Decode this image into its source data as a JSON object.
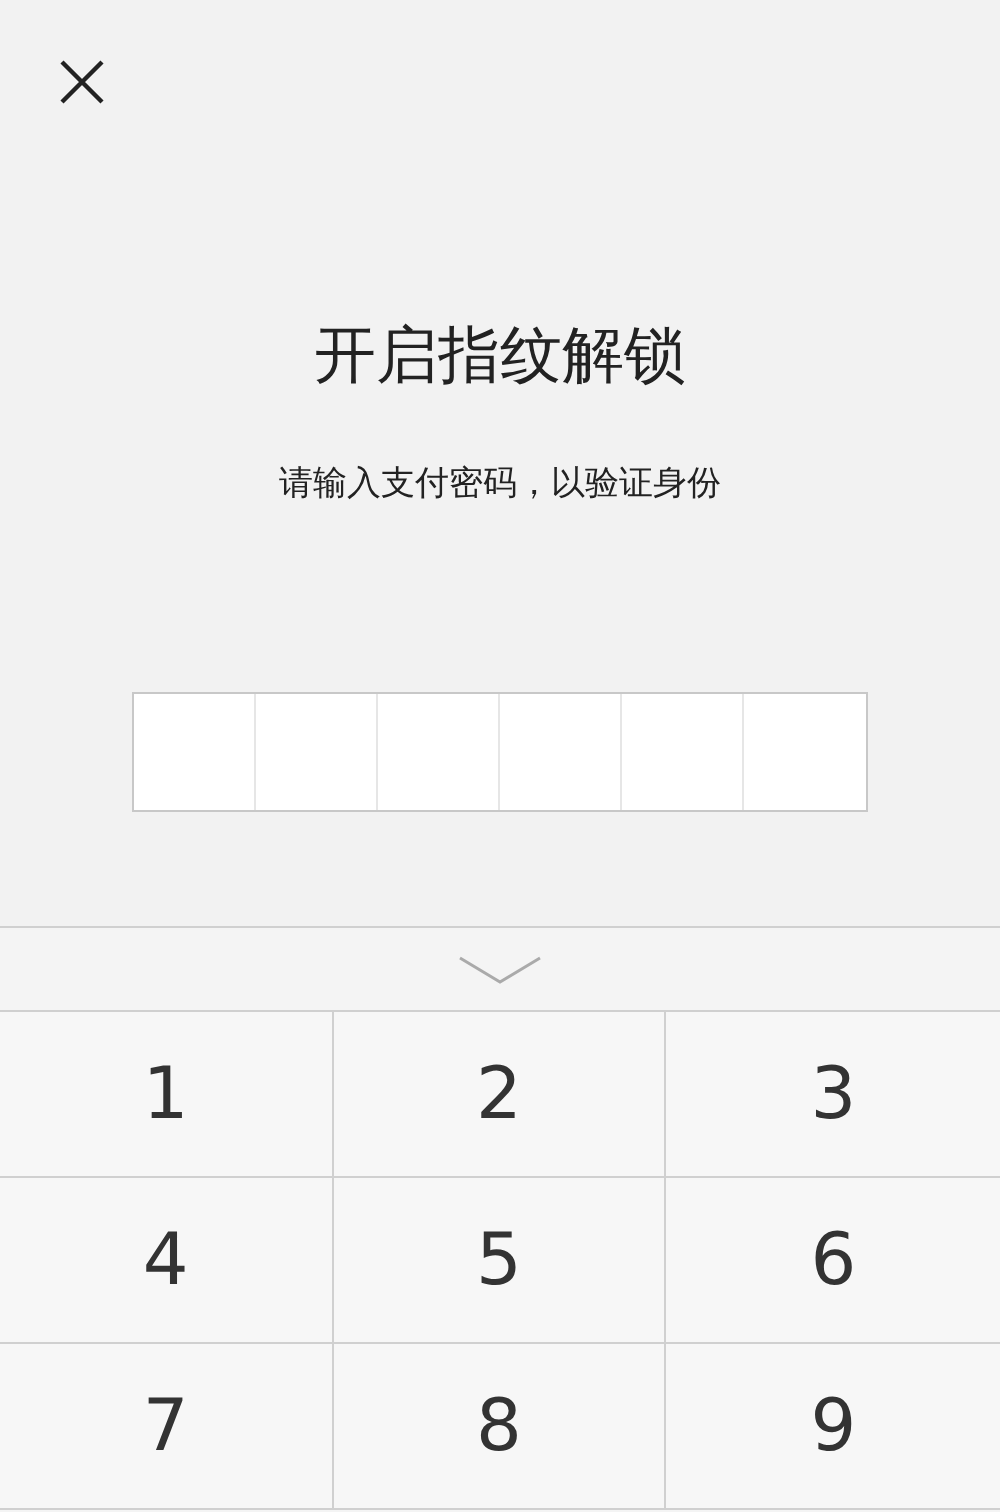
{
  "title": "开启指纹解锁",
  "subtitle": "请输入支付密码，以验证身份",
  "keypad": {
    "keys": [
      "1",
      "2",
      "3",
      "4",
      "5",
      "6",
      "7",
      "8",
      "9"
    ]
  }
}
